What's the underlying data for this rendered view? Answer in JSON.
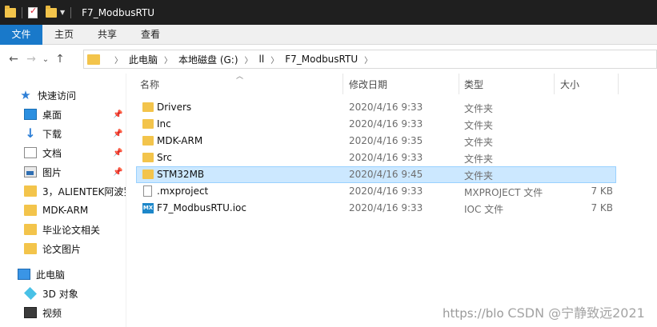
{
  "window": {
    "title": "F7_ModbusRTU"
  },
  "ribbon": {
    "tabs": [
      "文件",
      "主页",
      "共享",
      "查看"
    ]
  },
  "nav": {
    "back": "←",
    "forward": "→",
    "recent": "⌄",
    "up": "↑"
  },
  "address": {
    "crumbs": [
      "此电脑",
      "本地磁盘 (G:)",
      "ll",
      "F7_ModbusRTU"
    ]
  },
  "sidebar": {
    "items": [
      {
        "label": "快速访问",
        "icon": "star-icon"
      },
      {
        "label": "桌面",
        "icon": "desktop-icon",
        "pinned": true
      },
      {
        "label": "下载",
        "icon": "download-icon",
        "pinned": true
      },
      {
        "label": "文档",
        "icon": "document-icon",
        "pinned": true
      },
      {
        "label": "图片",
        "icon": "pictures-icon",
        "pinned": true
      },
      {
        "label": "3，ALIENTEK阿波罗",
        "icon": "folder-icon"
      },
      {
        "label": "MDK-ARM",
        "icon": "folder-icon"
      },
      {
        "label": "毕业论文相关",
        "icon": "folder-icon"
      },
      {
        "label": "论文图片",
        "icon": "folder-icon"
      },
      {
        "label": "此电脑",
        "icon": "computer-icon"
      },
      {
        "label": "3D 对象",
        "icon": "3d-objects-icon"
      },
      {
        "label": "视频",
        "icon": "video-icon"
      }
    ]
  },
  "columns": {
    "name": "名称",
    "date": "修改日期",
    "type": "类型",
    "size": "大小"
  },
  "files": [
    {
      "name": "Drivers",
      "date": "2020/4/16 9:33",
      "type": "文件夹",
      "size": "",
      "icon": "folder"
    },
    {
      "name": "Inc",
      "date": "2020/4/16 9:33",
      "type": "文件夹",
      "size": "",
      "icon": "folder"
    },
    {
      "name": "MDK-ARM",
      "date": "2020/4/16 9:35",
      "type": "文件夹",
      "size": "",
      "icon": "folder"
    },
    {
      "name": "Src",
      "date": "2020/4/16 9:33",
      "type": "文件夹",
      "size": "",
      "icon": "folder"
    },
    {
      "name": "STM32MB",
      "date": "2020/4/16 9:45",
      "type": "文件夹",
      "size": "",
      "icon": "folder",
      "selected": true
    },
    {
      "name": ".mxproject",
      "date": "2020/4/16 9:33",
      "type": "MXPROJECT 文件",
      "size": "7 KB",
      "icon": "file"
    },
    {
      "name": "F7_ModbusRTU.ioc",
      "date": "2020/4/16 9:33",
      "type": "IOC 文件",
      "size": "7 KB",
      "icon": "mx"
    }
  ],
  "watermark": {
    "url": "https://blo",
    "brand": "CSDN @宁静致远2021"
  },
  "colors": {
    "titlebar": "#1f1f1f",
    "file_tab": "#1979ca",
    "selection": "#cce8ff",
    "folder": "#f3c44b"
  }
}
